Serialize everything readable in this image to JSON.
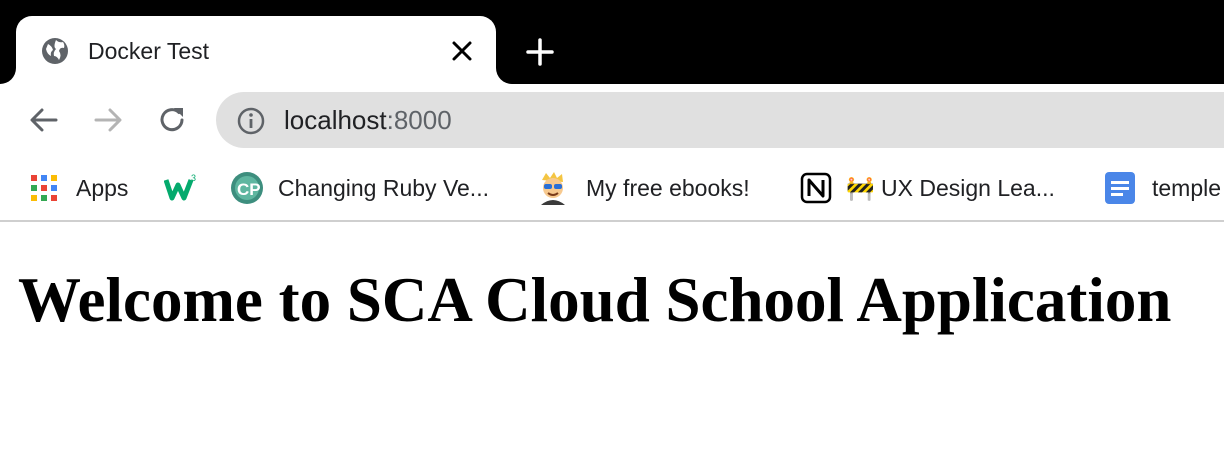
{
  "tab": {
    "title": "Docker Test",
    "favicon": "globe-icon"
  },
  "toolbar": {
    "back_icon": "arrow-left-icon",
    "forward_icon": "arrow-right-icon",
    "reload_icon": "reload-icon",
    "url_host": "localhost",
    "url_port": ":8000"
  },
  "bookmarks": [
    {
      "label": "Apps",
      "icon": "apps-grid-icon"
    },
    {
      "label": "",
      "icon": "w3-logo-icon"
    },
    {
      "label": "Changing Ruby Ve...",
      "icon": "cp-logo-icon"
    },
    {
      "label": "My free ebooks!",
      "icon": "avatar-emoji-icon"
    },
    {
      "label": "🚧 UX Design Lea...",
      "icon": "notion-icon"
    },
    {
      "label": "temple",
      "icon": "docs-icon"
    }
  ],
  "page": {
    "heading": "Welcome to SCA Cloud School Application"
  },
  "colors": {
    "tab_strip": "#000000",
    "omnibox": "#e0e0e0",
    "text": "#202124"
  }
}
